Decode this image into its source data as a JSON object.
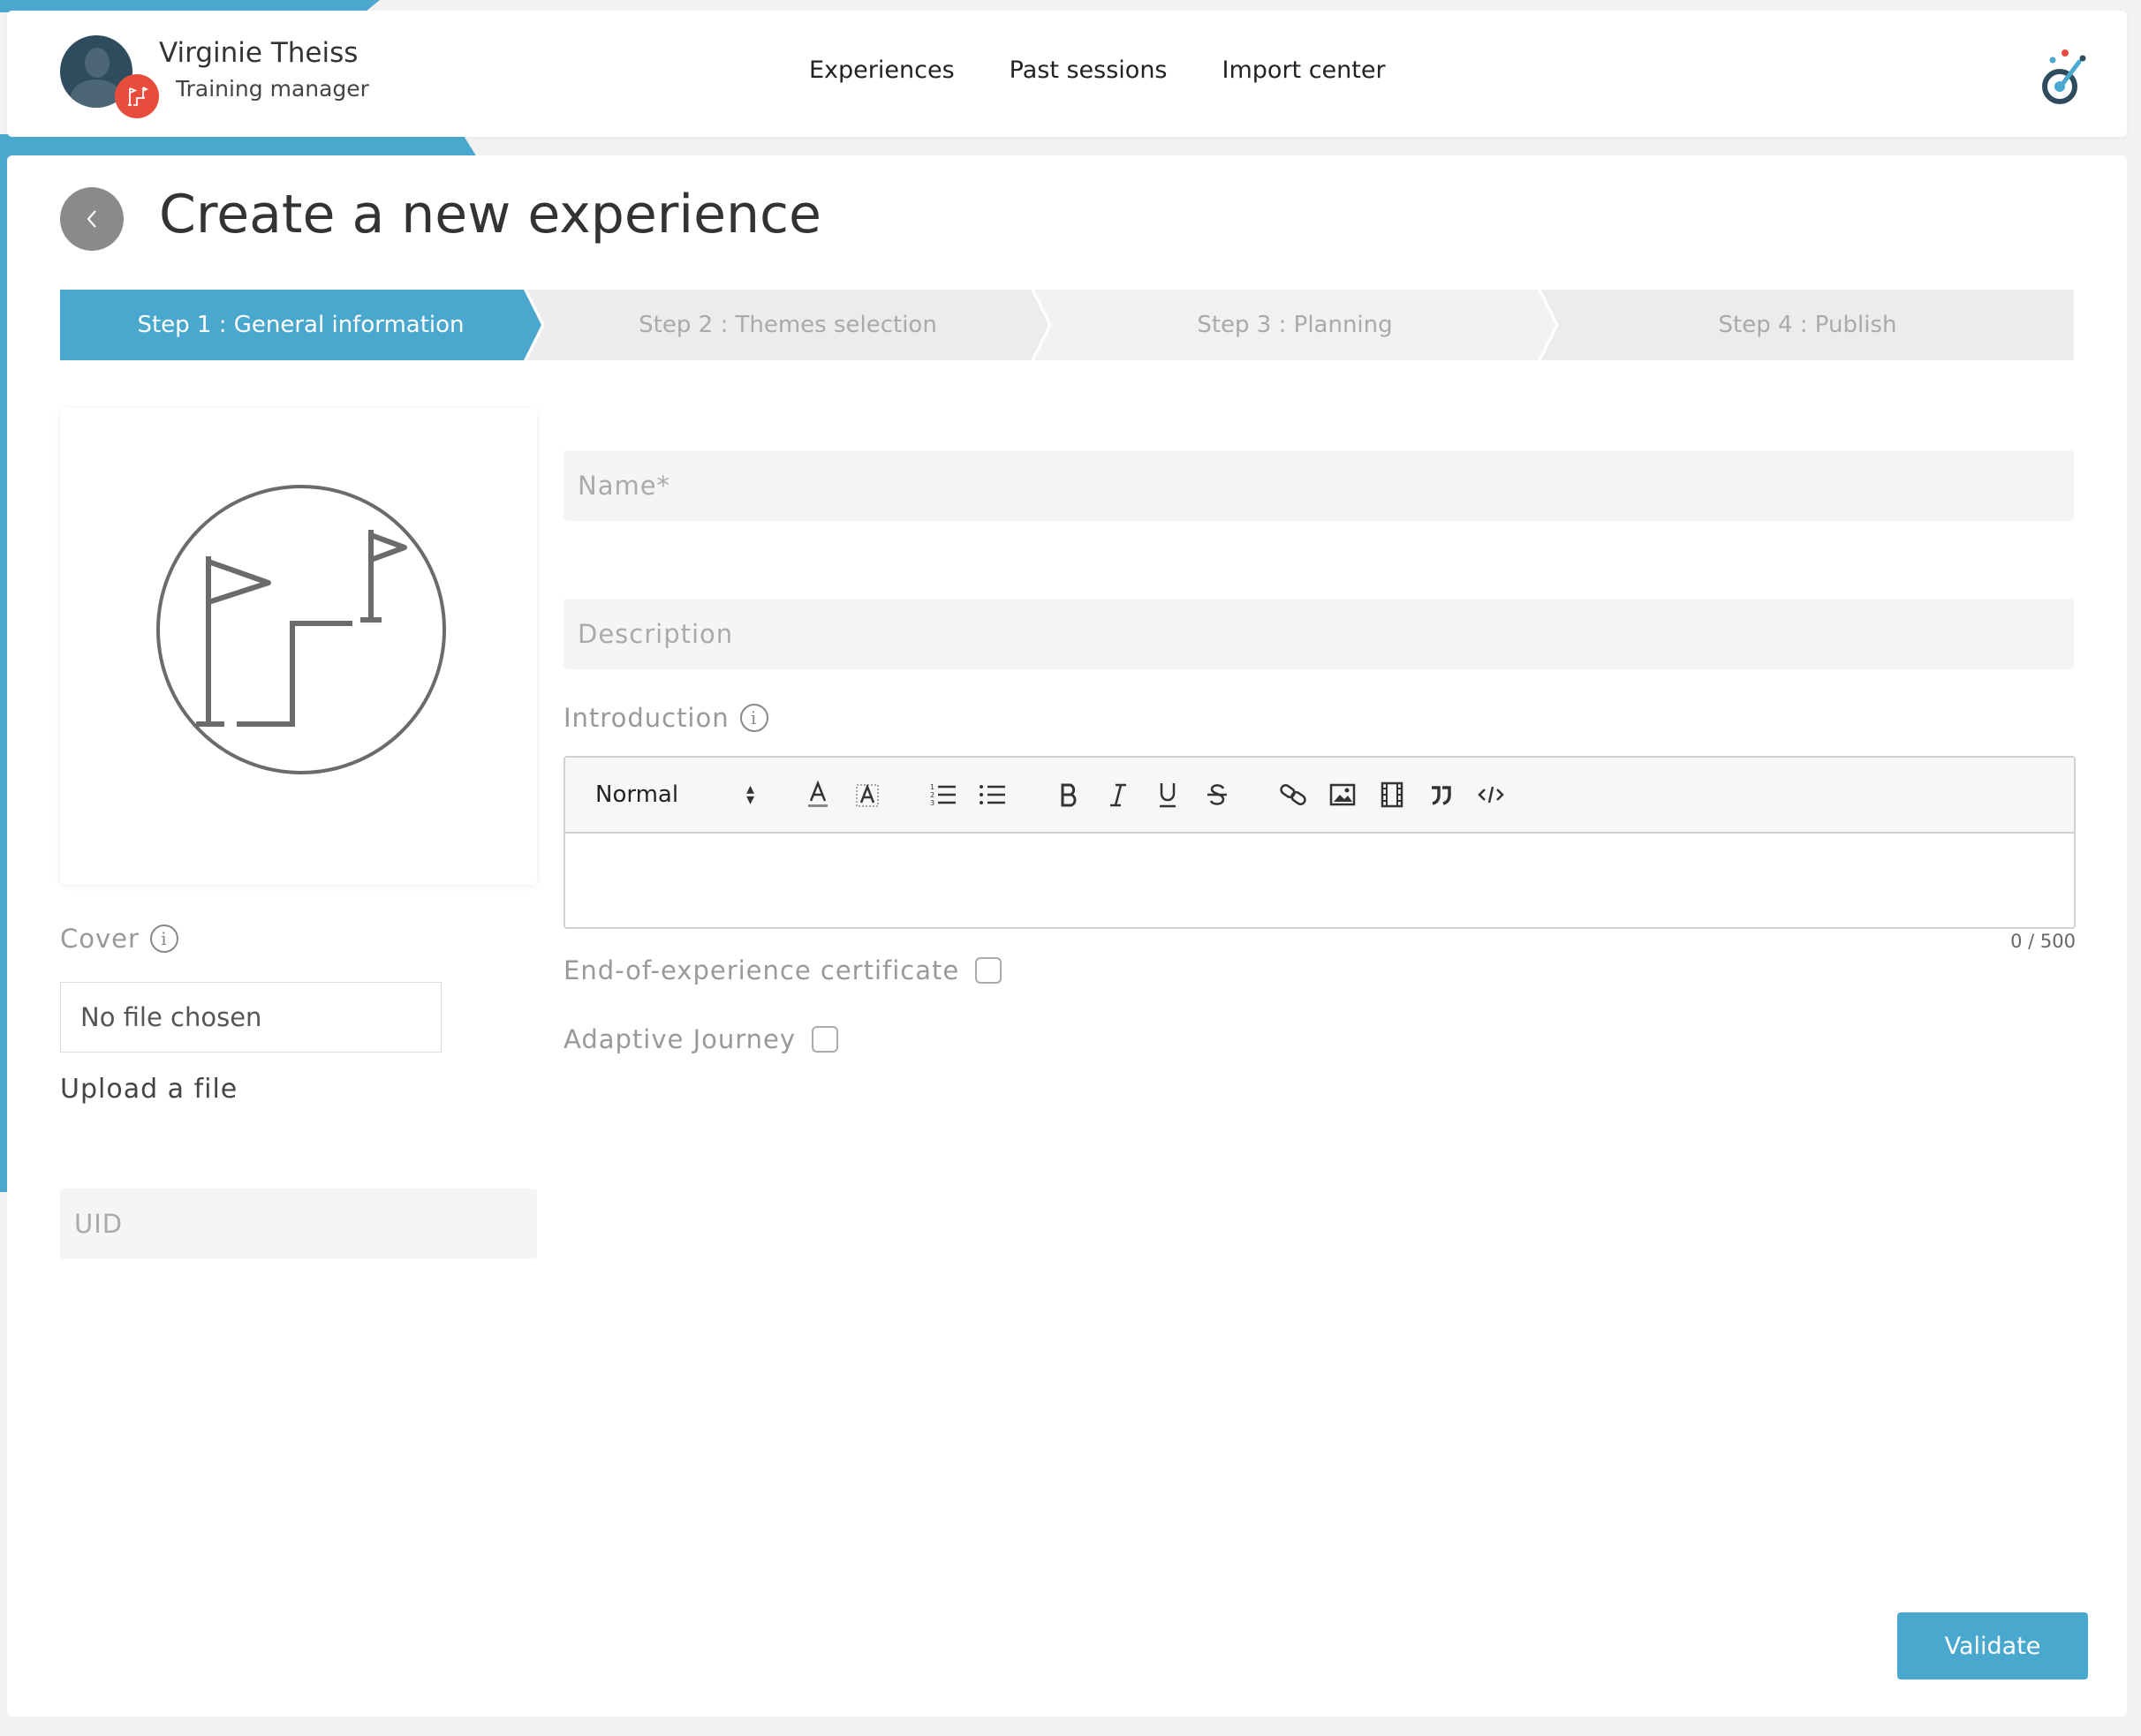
{
  "user": {
    "name": "Virginie Theiss",
    "role": "Training manager"
  },
  "nav": {
    "items": [
      "Experiences",
      "Past sessions",
      "Import center"
    ]
  },
  "page": {
    "title": "Create a new experience"
  },
  "stepper": {
    "steps": [
      {
        "label": "Step 1 : General information",
        "active": true
      },
      {
        "label": "Step 2 : Themes selection",
        "active": false
      },
      {
        "label": "Step 3 : Planning",
        "active": false
      },
      {
        "label": "Step 4 : Publish",
        "active": false
      }
    ]
  },
  "cover": {
    "label": "Cover",
    "file_status": "No file chosen",
    "upload_label": "Upload a file"
  },
  "form": {
    "name_placeholder": "Name*",
    "description_placeholder": "Description",
    "uid_placeholder": "UID",
    "introduction_label": "Introduction",
    "char_count": "0 / 500",
    "certificate_label": "End-of-experience certificate",
    "adaptive_label": "Adaptive Journey"
  },
  "editor": {
    "format_value": "Normal",
    "tools": [
      "text-color",
      "background-color",
      "ordered-list",
      "bullet-list",
      "bold",
      "italic",
      "underline",
      "strike",
      "link",
      "image",
      "video",
      "blockquote",
      "code-block"
    ]
  },
  "actions": {
    "validate_label": "Validate"
  },
  "colors": {
    "accent": "#4aa8cf",
    "badge": "#e84c3d"
  }
}
